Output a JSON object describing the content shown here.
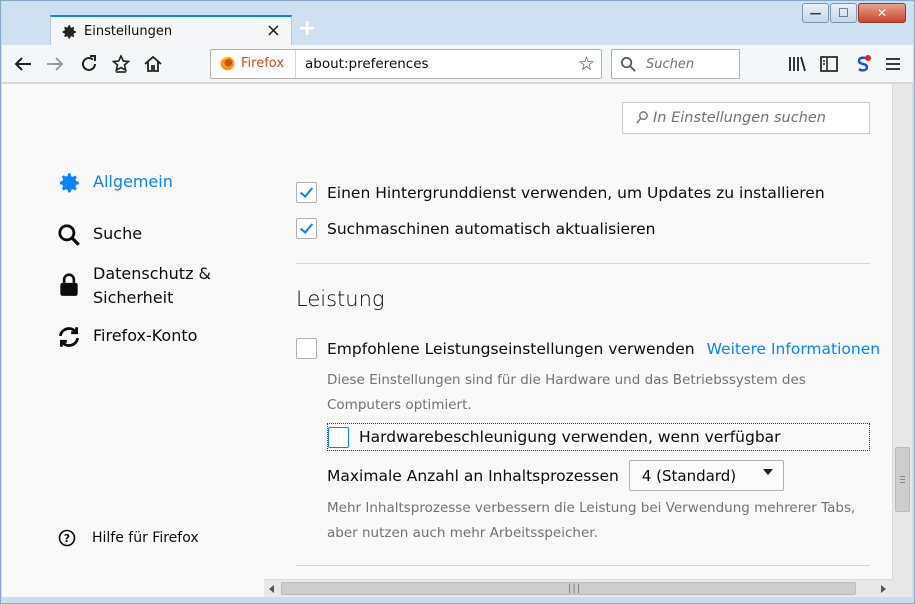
{
  "window": {
    "tab_title": "Einstellungen",
    "tab_close": "×",
    "new_tab": "+",
    "minimize": "—",
    "maximize": "☐",
    "close": "✕"
  },
  "navbar": {
    "identity_label": "Firefox",
    "url": "about:preferences",
    "search_placeholder": "Suchen"
  },
  "preferences": {
    "find_placeholder": "In Einstellungen suchen",
    "categories": [
      {
        "label": "Allgemein",
        "icon": "gear-icon",
        "selected": true
      },
      {
        "label": "Suche",
        "icon": "search-icon"
      },
      {
        "label": "Datenschutz & Sicherheit",
        "icon": "lock-icon"
      },
      {
        "label": "Firefox-Konto",
        "icon": "sync-icon"
      }
    ],
    "help": "Hilfe für Firefox",
    "updates": {
      "background_service": "Einen Hintergrunddienst verwenden, um Updates zu installieren",
      "background_service_checked": true,
      "search_engines": "Suchmaschinen automatisch aktualisieren",
      "search_engines_checked": true
    },
    "performance": {
      "heading": "Leistung",
      "recommended_label": "Empfohlene Leistungseinstellungen verwenden",
      "recommended_checked": false,
      "more_info": "Weitere Informationen",
      "recommended_desc": "Diese Einstellungen sind für die Hardware und das Betriebssystem des Computers optimiert.",
      "hw_accel_label": "Hardwarebeschleunigung verwenden, wenn verfügbar",
      "hw_accel_checked": false,
      "process_label": "Maximale Anzahl an Inhaltsprozessen",
      "process_value": "4 (Standard)",
      "process_desc": "Mehr Inhaltsprozesse verbessern die Leistung bei Verwendung mehrerer Tabs, aber nutzen auch mehr Arbeitsspeicher."
    }
  },
  "colors": {
    "accent": "#0a84ff",
    "firefox_orange": "#d14d1f"
  }
}
